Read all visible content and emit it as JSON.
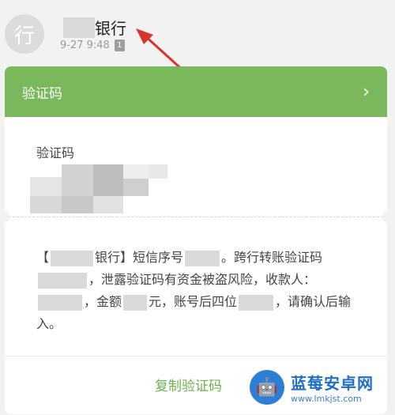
{
  "header": {
    "avatar_text": "行",
    "sender_name": "银行",
    "time": "9-27 9:48",
    "sim_badge": "1"
  },
  "card": {
    "title": "验证码",
    "code_label": "验证码",
    "message": {
      "part1": "【",
      "part2": "银行】短信序号",
      "part3": "。跨行转账验证码",
      "part4": "，泄露验证码有资金被盗风险，收款人：",
      "part5": "，金额",
      "part6": "元，账号后四位",
      "part7": "，请确认后输入。"
    },
    "copy_button": "复制验证码"
  },
  "watermark": {
    "title": "蓝莓安卓网",
    "url": "www.lmkjst.com"
  },
  "colors": {
    "accent_green": "#7ab85c",
    "annotation_red": "#d9342b"
  },
  "icons": {
    "chevron": "chevron-right-icon",
    "arrow": "annotation-arrow-icon"
  }
}
